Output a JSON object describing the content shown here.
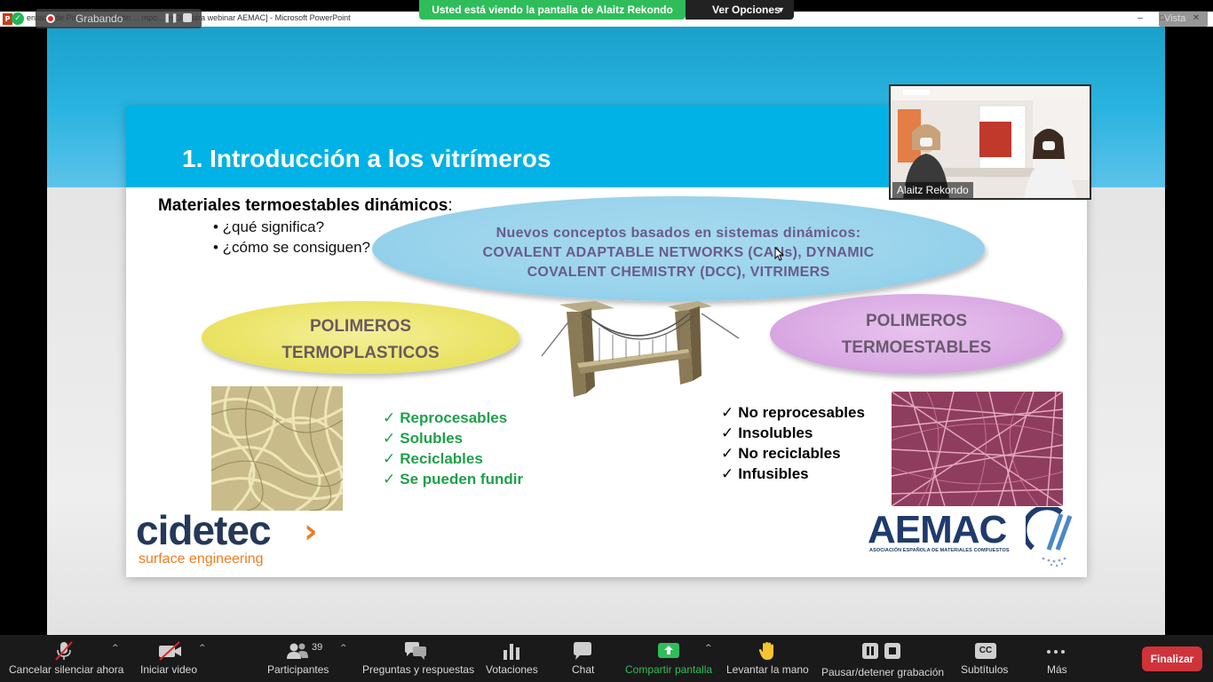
{
  "zoom": {
    "share_banner": "Usted está viendo la pantalla de Alaitz Rekondo",
    "view_options": "Ver Opciones",
    "recording_label": "Grabando",
    "view_button": "Vista",
    "participant_name": "Alaitz Rekondo"
  },
  "powerpoint": {
    "window_title": "entac... de Po... presentación ... mpo... es 3R para webinar AEMAC] - Microsoft PowerPoint",
    "app_icon_letter": "P",
    "minimize_icon": "–",
    "maximize_icon": "□",
    "close_icon": "✕"
  },
  "slide": {
    "title": "1. Introducción a los vitrímeros",
    "heading_bold": "Materiales termoestables dinámicos",
    "heading_suffix": ":",
    "bullets": [
      "• ¿qué significa?",
      "• ¿cómo se consiguen?"
    ],
    "top_ellipse_lines": [
      "Nuevos conceptos basados en sistemas dinámicos:",
      "COVALENT ADAPTABLE NETWORKS (CANs), DYNAMIC",
      "COVALENT CHEMISTRY (DCC), VITRIMERS"
    ],
    "left_ellipse_lines": [
      "POLIMEROS",
      "TERMOPLASTICOS"
    ],
    "right_ellipse_lines": [
      "POLIMEROS",
      "TERMOESTABLES"
    ],
    "check_mark": "✓",
    "thermoplastic_props": [
      "Reprocesables",
      "Solubles",
      "Reciclables",
      "Se pueden fundir"
    ],
    "thermoset_props": [
      "No reprocesables",
      "Insolubles",
      "No reciclables",
      "Infusibles"
    ],
    "cidetec_logo": "cidetec",
    "cidetec_arrow": "›",
    "cidetec_sub": "surface engineering",
    "aemac_logo": "AEMAC",
    "aemac_sub": "ASOCIACIÓN ESPAÑOLA DE MATERIALES COMPUESTOS"
  },
  "toolbar": {
    "mute": "Cancelar silenciar ahora",
    "video": "Iniciar video",
    "participants": "Participantes",
    "participants_count": "39",
    "qa": "Preguntas y respuestas",
    "polls": "Votaciones",
    "chat": "Chat",
    "share": "Compartir pantalla",
    "raise_hand": "Levantar la mano",
    "pause_record": "Pausar/detener grabación",
    "subtitles": "Subtítulos",
    "subtitles_icon_text": "CC",
    "more": "Más",
    "end": "Finalizar",
    "caret": "^"
  },
  "colors": {
    "slide_blue": "#00b2e5",
    "green_text": "#1fa04a",
    "share_green": "#2fbd5b",
    "end_red": "#d0323a",
    "cidetec_orange": "#ef7d22",
    "navy": "#243858"
  }
}
